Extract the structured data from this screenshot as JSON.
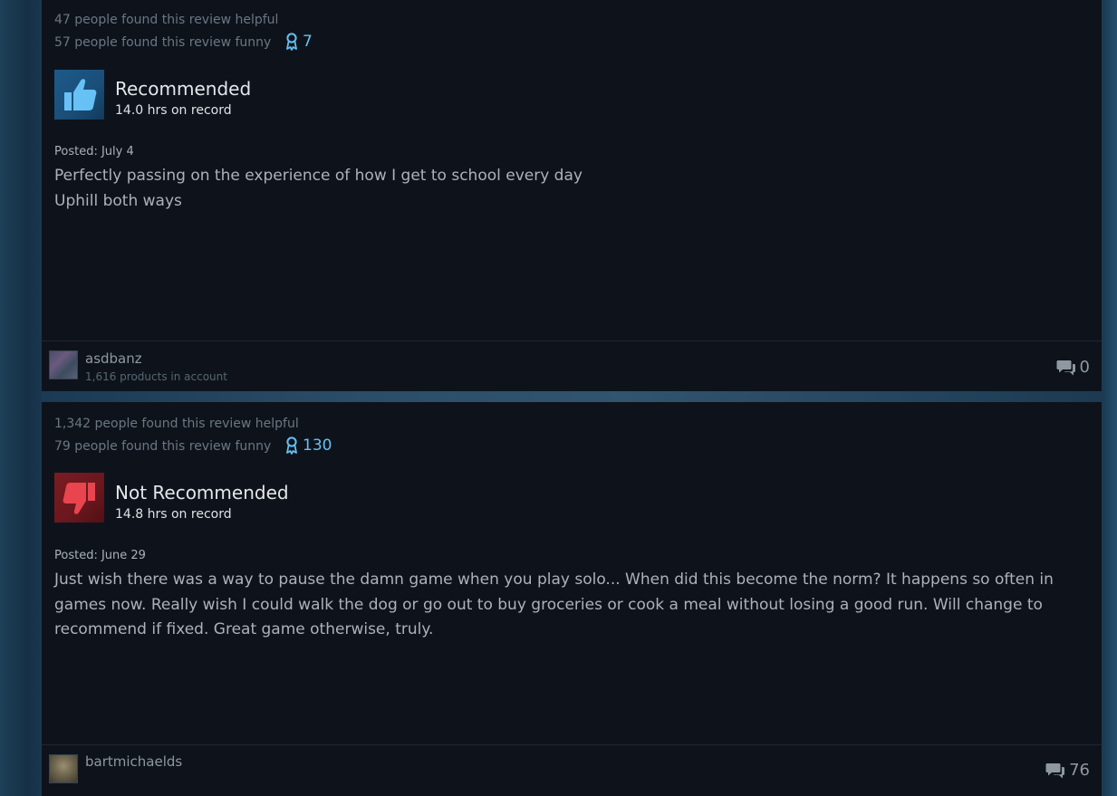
{
  "reviews": [
    {
      "helpful": "47 people found this review helpful",
      "funny": "57 people found this review funny",
      "award_count": "7",
      "recommendation": "Recommended",
      "recommendation_icon": "thumbs-up-icon",
      "hours": "14.0 hrs on record",
      "posted": "Posted: July 4",
      "text_lines": [
        "Perfectly passing on the experience of how I get to school every day",
        "Uphill both ways"
      ],
      "username": "asdbanz",
      "products": "1,616 products in account",
      "comment_count": "0"
    },
    {
      "helpful": "1,342 people found this review helpful",
      "funny": "79 people found this review funny",
      "award_count": "130",
      "recommendation": "Not Recommended",
      "recommendation_icon": "thumbs-down-icon",
      "hours": "14.8 hrs on record",
      "posted": "Posted: June 29",
      "text": "Just wish there was a way to pause the damn game when you play solo... When did this become the norm? It happens so often in games now. Really wish I could walk the dog or go out to buy groceries or cook a meal without losing a good run. Will change to recommend if fixed. Great game otherwise, truly.",
      "username": "bartmichaelds",
      "comment_count": "76"
    }
  ],
  "colors": {
    "card_bg": "#0e131b",
    "accent_blue": "#66c0f4",
    "recommended_bg": "#1c5a8a",
    "not_recommended_bg": "#7a1c22"
  }
}
